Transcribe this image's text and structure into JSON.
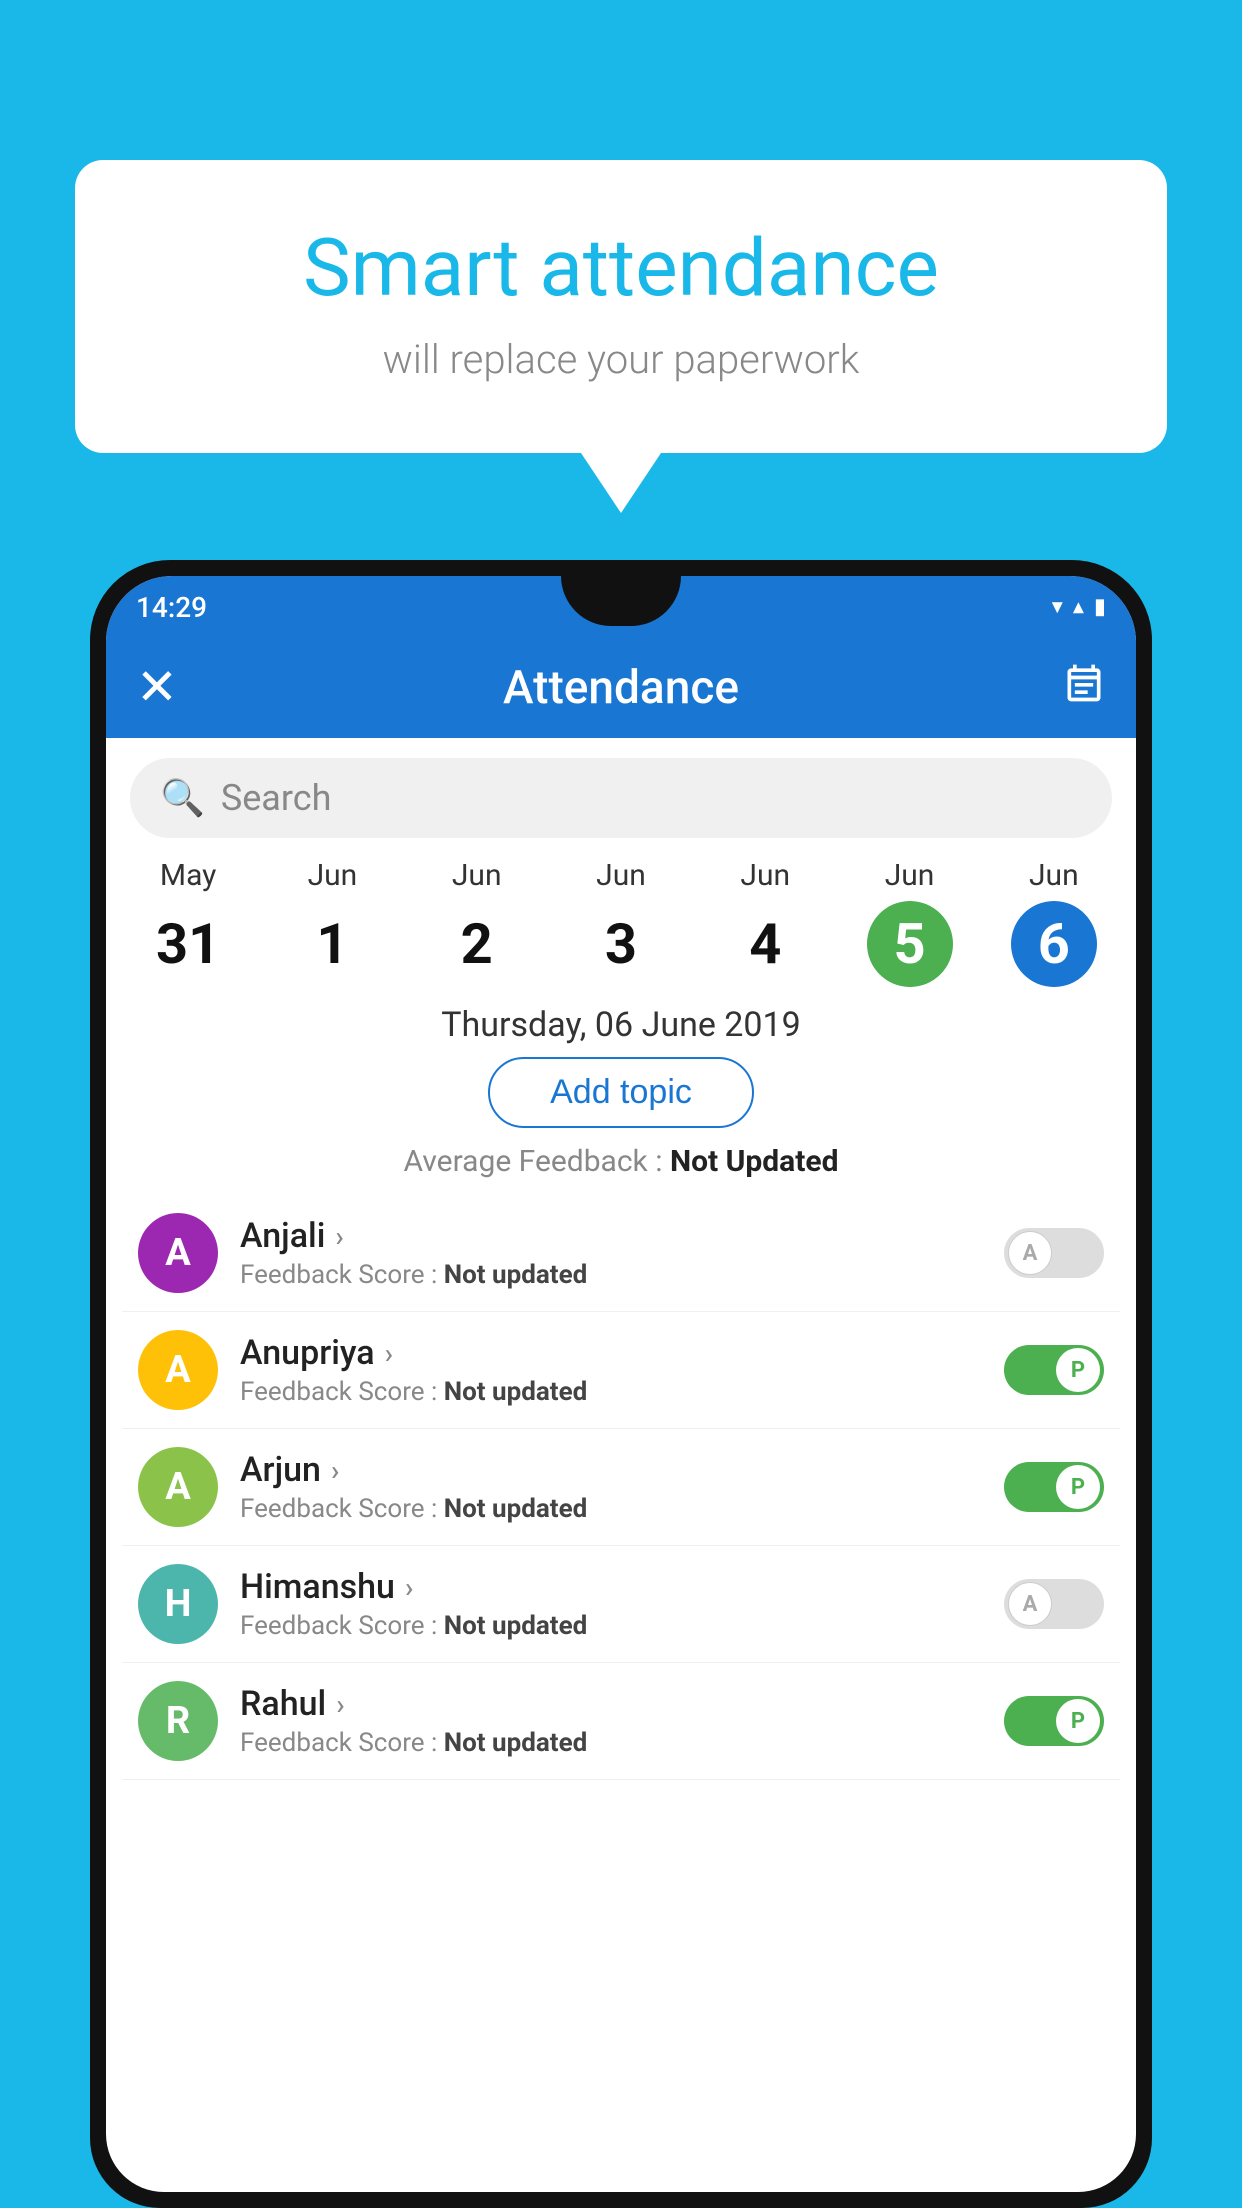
{
  "background_color": "#1ab8e8",
  "speech_bubble": {
    "title": "Smart attendance",
    "subtitle": "will replace your paperwork"
  },
  "status_bar": {
    "time": "14:29",
    "wifi_icon": "▼",
    "signal_icon": "▲",
    "battery_icon": "▮"
  },
  "app_bar": {
    "title": "Attendance",
    "close_label": "×",
    "calendar_icon": "📅"
  },
  "search": {
    "placeholder": "Search"
  },
  "calendar": {
    "dates": [
      {
        "month": "May",
        "day": "31",
        "active": false
      },
      {
        "month": "Jun",
        "day": "1",
        "active": false
      },
      {
        "month": "Jun",
        "day": "2",
        "active": false
      },
      {
        "month": "Jun",
        "day": "3",
        "active": false
      },
      {
        "month": "Jun",
        "day": "4",
        "active": false
      },
      {
        "month": "Jun",
        "day": "5",
        "active": "green"
      },
      {
        "month": "Jun",
        "day": "6",
        "active": "blue"
      }
    ]
  },
  "selected_date": "Thursday, 06 June 2019",
  "add_topic_label": "Add topic",
  "avg_feedback_label": "Average Feedback :",
  "avg_feedback_value": "Not Updated",
  "students": [
    {
      "name": "Anjali",
      "avatar_letter": "A",
      "avatar_color": "purple",
      "feedback_label": "Feedback Score :",
      "feedback_value": "Not updated",
      "toggle": "off",
      "toggle_letter": "A"
    },
    {
      "name": "Anupriya",
      "avatar_letter": "A",
      "avatar_color": "yellow",
      "feedback_label": "Feedback Score :",
      "feedback_value": "Not updated",
      "toggle": "on",
      "toggle_letter": "P"
    },
    {
      "name": "Arjun",
      "avatar_letter": "A",
      "avatar_color": "green",
      "feedback_label": "Feedback Score :",
      "feedback_value": "Not updated",
      "toggle": "on",
      "toggle_letter": "P"
    },
    {
      "name": "Himanshu",
      "avatar_letter": "H",
      "avatar_color": "teal",
      "feedback_label": "Feedback Score :",
      "feedback_value": "Not updated",
      "toggle": "off",
      "toggle_letter": "A"
    },
    {
      "name": "Rahul",
      "avatar_letter": "R",
      "avatar_color": "green2",
      "feedback_label": "Feedback Score :",
      "feedback_value": "Not updated",
      "toggle": "on",
      "toggle_letter": "P"
    }
  ]
}
